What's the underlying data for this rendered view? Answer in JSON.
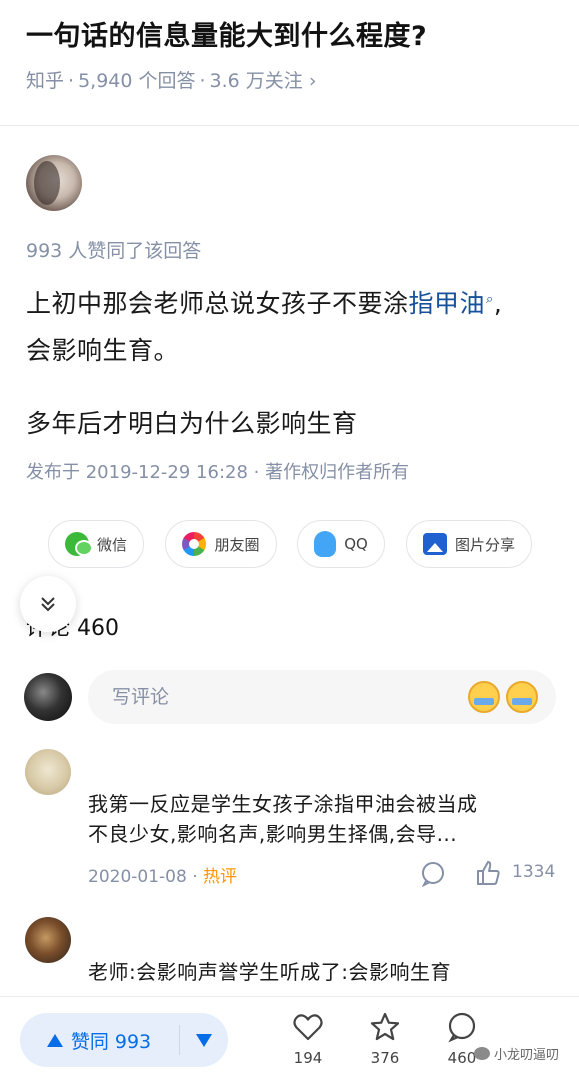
{
  "question": {
    "title": "一句话的信息量能大到什么程度?",
    "source": "知乎",
    "answers": "5,940 个回答",
    "followers": "3.6 万关注",
    "chevron": "›"
  },
  "answer": {
    "agree_line": "993 人赞同了该回答",
    "line1_before": "上初中那会老师总说女孩子不要涂",
    "line1_keyword": "指甲油",
    "line1_after": ",",
    "line2": "会影响生育。",
    "line3": "多年后才明白为什么影响生育",
    "published": "发布于 2019-12-29 16:28 · 著作权归作者所有"
  },
  "share": {
    "wechat": "微信",
    "moments": "朋友圈",
    "qq": "QQ",
    "image": "图片分享"
  },
  "comments": {
    "heading": "评论 460",
    "input_placeholder": "写评论",
    "items": [
      {
        "line1": "我第一反应是学生女孩子涂指甲油会被当成",
        "line2": "不良少女,影响名声,影响男生择偶,会导...",
        "date": "2020-01-08",
        "tag": "热评",
        "likes": "1334"
      },
      {
        "line1": "老师:会影响声誉学生听成了:会影响生育"
      }
    ]
  },
  "bottom_bar": {
    "vote_label": "赞同 993",
    "likes": "194",
    "favorites": "376",
    "comments": "460"
  },
  "watermark": "小龙叨逼叨",
  "icons": {
    "collapse": "double-chevron-down-icon",
    "keyword_search": "search-icon"
  },
  "colors": {
    "link_blue": "#175199",
    "vote_blue": "#056de8",
    "meta_gray": "#8590a6",
    "hot_orange": "#ff9607"
  }
}
